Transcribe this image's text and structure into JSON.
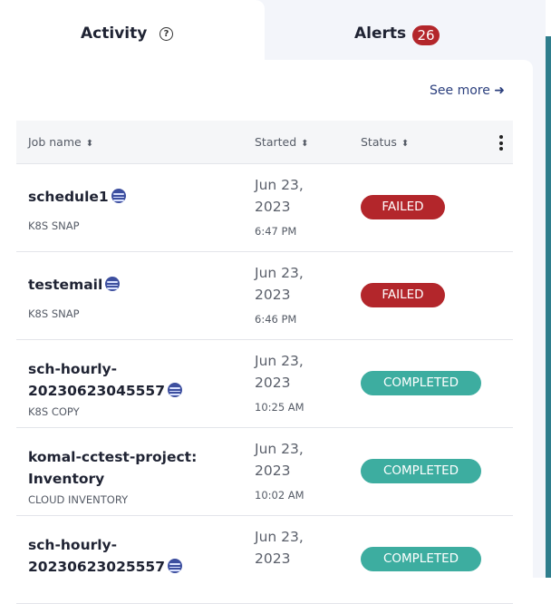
{
  "tabs": {
    "activity": {
      "label": "Activity"
    },
    "alerts": {
      "label": "Alerts",
      "count": "26"
    }
  },
  "see_more": {
    "label": "See more",
    "arrow": "➜"
  },
  "table": {
    "columns": [
      {
        "label": "Job name"
      },
      {
        "label": "Started"
      },
      {
        "label": "Status"
      }
    ],
    "rows": [
      {
        "name": "schedule1",
        "type": "K8S SNAP",
        "date": "Jun 23, 2023",
        "time": "6:47 PM",
        "status": "FAILED",
        "status_kind": "failed",
        "icon": "snap-icon"
      },
      {
        "name": "testemail",
        "type": "K8S SNAP",
        "date": "Jun 23, 2023",
        "time": "6:46 PM",
        "status": "FAILED",
        "status_kind": "failed",
        "icon": "snap-icon"
      },
      {
        "name": "sch-hourly-20230623045557",
        "type": "K8S COPY",
        "date": "Jun 23, 2023",
        "time": "10:25 AM",
        "status": "COMPLETED",
        "status_kind": "completed",
        "icon": "snap-icon"
      },
      {
        "name": "komal-cctest-project: Inventory",
        "type": "CLOUD INVENTORY",
        "date": "Jun 23, 2023",
        "time": "10:02 AM",
        "status": "COMPLETED",
        "status_kind": "completed",
        "icon": ""
      },
      {
        "name": "sch-hourly-20230623025557",
        "type": "",
        "date": "Jun 23, 2023",
        "time": "",
        "status": "COMPLETED",
        "status_kind": "completed",
        "icon": "snap-icon"
      }
    ]
  },
  "colors": {
    "failed": "#b3262b",
    "completed": "#3dada0",
    "link": "#2b3f7d"
  }
}
